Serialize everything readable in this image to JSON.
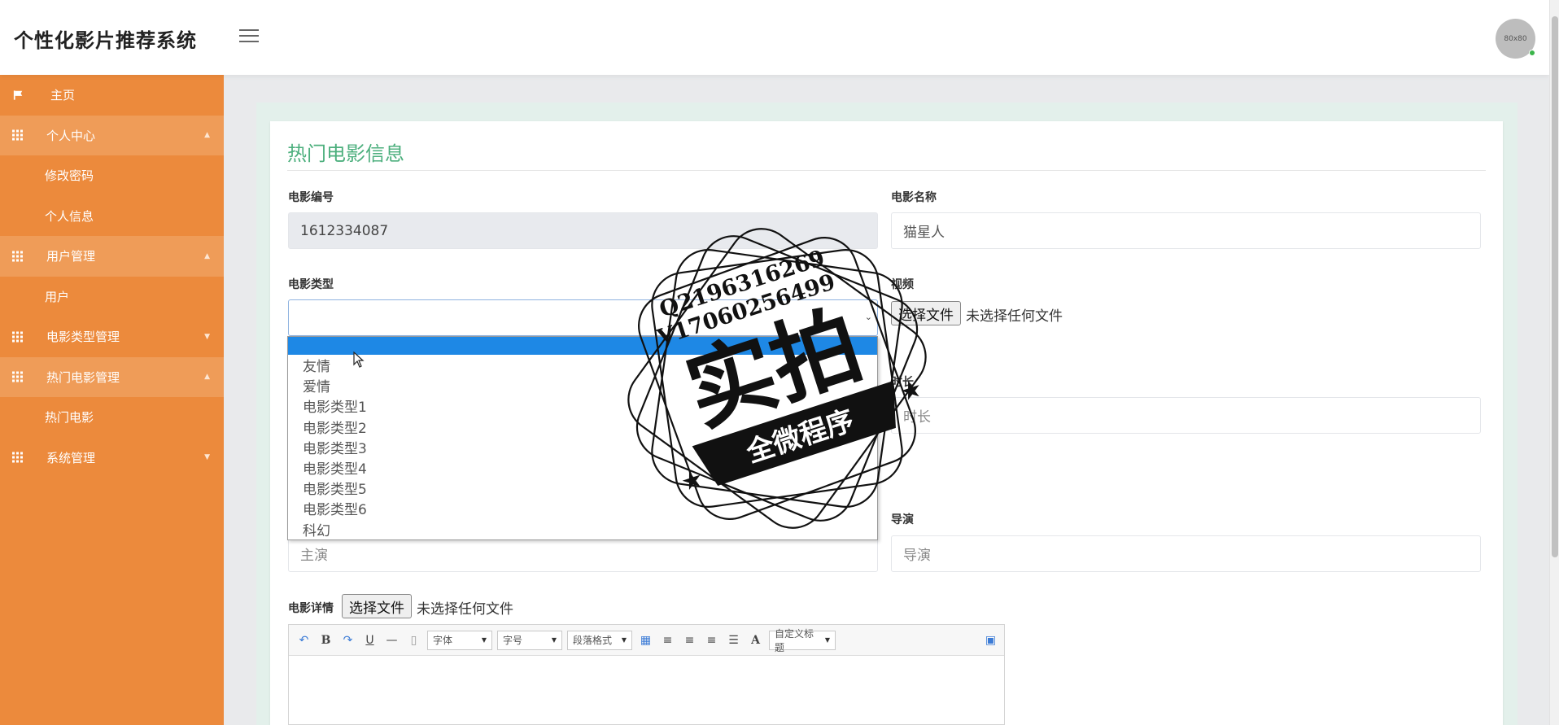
{
  "app": {
    "title": "个性化影片推荐系统",
    "avatar_text": "80x80"
  },
  "sidebar": {
    "home": "主页",
    "groups": [
      {
        "label": "个人中心",
        "items": [
          "修改密码",
          "个人信息"
        ]
      },
      {
        "label": "用户管理",
        "items": [
          "用户"
        ]
      },
      {
        "label": "电影类型管理",
        "items": []
      },
      {
        "label": "热门电影管理",
        "items": [
          "热门电影"
        ]
      },
      {
        "label": "系统管理",
        "items": []
      }
    ]
  },
  "form": {
    "title": "热门电影信息",
    "movie_id": {
      "label": "电影编号",
      "value": "1612334087"
    },
    "movie_name": {
      "label": "电影名称",
      "value": "猫星人"
    },
    "movie_type": {
      "label": "电影类型",
      "value": ""
    },
    "video": {
      "label": "视频",
      "button": "选择文件",
      "status": "未选择任何文件"
    },
    "duration": {
      "label": "时长",
      "placeholder": "时长"
    },
    "director": {
      "label": "导演",
      "placeholder": "导演"
    },
    "actor": {
      "placeholder": "主演"
    },
    "detail": {
      "label": "电影详情",
      "button": "选择文件",
      "status": "未选择任何文件"
    }
  },
  "type_options": [
    "",
    "友情",
    "爱情",
    "电影类型1",
    "电影类型2",
    "电影类型3",
    "电影类型4",
    "电影类型5",
    "电影类型6",
    "科幻"
  ],
  "editor_toolbar": {
    "bold": "B",
    "underline": "U",
    "font_color": "A",
    "font_family": "字体",
    "font_size": "字号",
    "paragraph": "段落格式",
    "custom_title": "自定义标题"
  },
  "watermark": {
    "line1": "Q2196316269",
    "line2": "V17060256499",
    "main": "实拍",
    "banner": "全微程序"
  }
}
